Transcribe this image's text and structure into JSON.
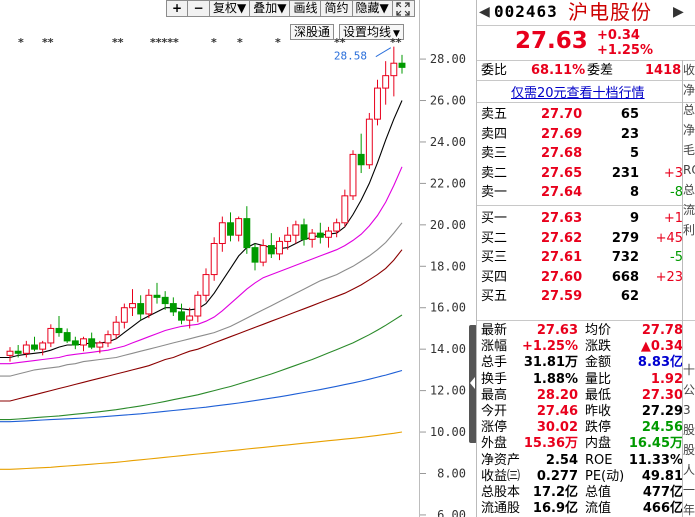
{
  "toolbar": {
    "plus": "+",
    "minus": "−",
    "fuquan": "复权▼",
    "diejia": "叠加▼",
    "huaxian": "画线",
    "jianyue": "简约",
    "yincang": "隐藏▼",
    "expand_icon": "expand-icon"
  },
  "buttons": {
    "deep": "深股通",
    "ma_settings": "设置均线",
    "ma_caret": "▼"
  },
  "annotation": {
    "high_label": "28.58"
  },
  "stars": [
    {
      "text": "*"
    },
    {
      "text": "**"
    },
    {
      "text": "**"
    },
    {
      "text": "*****"
    },
    {
      "text": "*"
    },
    {
      "text": "*"
    },
    {
      "text": "*"
    },
    {
      "text": "**"
    },
    {
      "text": "**"
    }
  ],
  "chart_data": {
    "type": "candlestick",
    "y_ticks": [
      "28.00",
      "26.00",
      "24.00",
      "22.00",
      "20.00",
      "18.00",
      "16.00",
      "14.00",
      "12.00",
      "10.00",
      "8.00",
      "6.00"
    ],
    "ylim": [
      5.9,
      29.5
    ],
    "candles": [
      [
        13.7,
        14.1,
        13.4,
        13.9
      ],
      [
        13.9,
        14.2,
        13.6,
        13.8
      ],
      [
        13.8,
        14.4,
        13.6,
        14.2
      ],
      [
        14.2,
        14.6,
        13.9,
        14.0
      ],
      [
        14.0,
        14.4,
        13.7,
        14.3
      ],
      [
        14.3,
        15.2,
        14.1,
        15.0
      ],
      [
        15.0,
        15.6,
        14.6,
        14.8
      ],
      [
        14.8,
        15.0,
        14.3,
        14.4
      ],
      [
        14.4,
        14.6,
        14.0,
        14.2
      ],
      [
        14.2,
        14.6,
        13.9,
        14.5
      ],
      [
        14.5,
        14.8,
        14.0,
        14.1
      ],
      [
        14.1,
        14.4,
        13.8,
        14.3
      ],
      [
        14.3,
        14.9,
        14.1,
        14.7
      ],
      [
        14.7,
        15.6,
        14.5,
        15.3
      ],
      [
        15.3,
        16.2,
        15.0,
        16.0
      ],
      [
        16.0,
        16.9,
        15.6,
        16.2
      ],
      [
        16.2,
        16.6,
        15.4,
        15.7
      ],
      [
        15.7,
        16.9,
        15.5,
        16.6
      ],
      [
        16.6,
        17.2,
        16.2,
        16.5
      ],
      [
        16.5,
        16.8,
        15.9,
        16.2
      ],
      [
        16.2,
        16.5,
        15.6,
        15.8
      ],
      [
        15.8,
        16.2,
        15.2,
        15.4
      ],
      [
        15.4,
        16.0,
        15.0,
        15.6
      ],
      [
        15.6,
        16.8,
        15.3,
        16.6
      ],
      [
        16.6,
        17.9,
        16.3,
        17.6
      ],
      [
        17.6,
        19.4,
        17.3,
        19.1
      ],
      [
        19.1,
        20.4,
        18.7,
        20.1
      ],
      [
        20.1,
        20.6,
        19.2,
        19.5
      ],
      [
        19.5,
        20.4,
        19.2,
        20.3
      ],
      [
        20.3,
        20.9,
        18.6,
        18.9
      ],
      [
        18.9,
        19.1,
        17.8,
        18.2
      ],
      [
        18.2,
        19.3,
        18.0,
        19.0
      ],
      [
        19.0,
        19.6,
        18.4,
        18.6
      ],
      [
        18.6,
        19.4,
        18.3,
        19.2
      ],
      [
        19.2,
        19.9,
        18.8,
        19.5
      ],
      [
        19.5,
        20.2,
        19.1,
        20.0
      ],
      [
        20.0,
        20.3,
        19.0,
        19.3
      ],
      [
        19.3,
        19.8,
        18.9,
        19.6
      ],
      [
        19.6,
        20.1,
        19.1,
        19.4
      ],
      [
        19.4,
        19.9,
        18.9,
        19.7
      ],
      [
        19.7,
        20.3,
        19.4,
        20.1
      ],
      [
        20.1,
        21.7,
        19.9,
        21.4
      ],
      [
        21.4,
        23.6,
        21.2,
        23.4
      ],
      [
        23.4,
        24.4,
        22.5,
        22.9
      ],
      [
        22.9,
        25.4,
        22.7,
        25.1
      ],
      [
        25.1,
        27.0,
        24.8,
        26.6
      ],
      [
        26.6,
        27.9,
        25.8,
        27.2
      ],
      [
        27.2,
        28.6,
        26.2,
        27.8
      ],
      [
        27.8,
        28.2,
        27.3,
        27.6
      ]
    ],
    "ma_lines": [
      {
        "color": "#000000",
        "values": [
          13.6,
          13.7,
          13.75,
          13.8,
          13.85,
          13.95,
          14.1,
          14.2,
          14.2,
          14.25,
          14.3,
          14.3,
          14.35,
          14.5,
          14.8,
          15.1,
          15.4,
          15.6,
          15.8,
          16.0,
          16.0,
          15.95,
          15.9,
          15.95,
          16.2,
          16.7,
          17.3,
          17.9,
          18.5,
          18.9,
          19.1,
          19.0,
          18.9,
          18.85,
          18.9,
          19.1,
          19.3,
          19.4,
          19.5,
          19.55,
          19.6,
          19.9,
          20.5,
          21.2,
          22.0,
          23.0,
          24.1,
          25.1,
          26.0
        ]
      },
      {
        "color": "#e000e0",
        "values": [
          13.3,
          13.35,
          13.4,
          13.45,
          13.5,
          13.55,
          13.6,
          13.7,
          13.75,
          13.8,
          13.85,
          13.9,
          13.95,
          14.05,
          14.15,
          14.3,
          14.45,
          14.6,
          14.75,
          14.9,
          15.0,
          15.1,
          15.15,
          15.2,
          15.35,
          15.55,
          15.85,
          16.2,
          16.55,
          16.9,
          17.2,
          17.45,
          17.6,
          17.75,
          17.9,
          18.05,
          18.2,
          18.35,
          18.5,
          18.65,
          18.8,
          19.0,
          19.25,
          19.55,
          19.95,
          20.45,
          21.1,
          21.9,
          22.8
        ]
      },
      {
        "color": "#8c8c8c",
        "values": [
          12.7,
          12.8,
          12.9,
          13.0,
          13.05,
          13.1,
          13.15,
          13.25,
          13.3,
          13.4,
          13.45,
          13.5,
          13.55,
          13.6,
          13.7,
          13.8,
          13.9,
          14.0,
          14.1,
          14.2,
          14.3,
          14.4,
          14.5,
          14.6,
          14.7,
          14.8,
          14.95,
          15.1,
          15.3,
          15.5,
          15.7,
          15.9,
          16.1,
          16.3,
          16.5,
          16.7,
          16.9,
          17.1,
          17.3,
          17.45,
          17.6,
          17.8,
          18.0,
          18.25,
          18.5,
          18.8,
          19.15,
          19.6,
          20.1
        ]
      },
      {
        "color": "#8b0000",
        "values": [
          11.5,
          11.6,
          11.7,
          11.8,
          11.9,
          12.0,
          12.1,
          12.2,
          12.3,
          12.4,
          12.5,
          12.6,
          12.7,
          12.8,
          12.9,
          13.0,
          13.1,
          13.2,
          13.35,
          13.5,
          13.6,
          13.75,
          13.9,
          14.0,
          14.15,
          14.3,
          14.45,
          14.6,
          14.75,
          14.9,
          15.05,
          15.2,
          15.35,
          15.5,
          15.65,
          15.8,
          15.95,
          16.1,
          16.25,
          16.4,
          16.55,
          16.7,
          16.9,
          17.1,
          17.35,
          17.6,
          17.9,
          18.3,
          18.8
        ]
      },
      {
        "color": "#2a8a2a",
        "values": [
          10.6,
          10.63,
          10.66,
          10.69,
          10.72,
          10.75,
          10.78,
          10.82,
          10.86,
          10.9,
          10.94,
          10.98,
          11.03,
          11.08,
          11.14,
          11.2,
          11.26,
          11.33,
          11.4,
          11.48,
          11.56,
          11.64,
          11.72,
          11.8,
          11.9,
          12.0,
          12.1,
          12.2,
          12.32,
          12.44,
          12.56,
          12.68,
          12.8,
          12.94,
          13.08,
          13.22,
          13.36,
          13.5,
          13.66,
          13.82,
          13.98,
          14.14,
          14.3,
          14.5,
          14.7,
          14.92,
          15.15,
          15.4,
          15.65
        ]
      },
      {
        "color": "#1e5fd6",
        "values": [
          10.5,
          10.52,
          10.54,
          10.56,
          10.58,
          10.6,
          10.62,
          10.64,
          10.66,
          10.68,
          10.7,
          10.73,
          10.76,
          10.79,
          10.82,
          10.85,
          10.88,
          10.92,
          10.96,
          11.0,
          11.04,
          11.08,
          11.12,
          11.16,
          11.2,
          11.25,
          11.3,
          11.35,
          11.4,
          11.46,
          11.52,
          11.58,
          11.64,
          11.7,
          11.77,
          11.84,
          11.91,
          11.98,
          12.05,
          12.13,
          12.21,
          12.29,
          12.37,
          12.46,
          12.55,
          12.65,
          12.75,
          12.86,
          12.97
        ]
      },
      {
        "color": "#e8a000",
        "values": [
          8.2,
          8.22,
          8.24,
          8.26,
          8.28,
          8.3,
          8.33,
          8.36,
          8.39,
          8.42,
          8.45,
          8.48,
          8.51,
          8.54,
          8.58,
          8.62,
          8.66,
          8.7,
          8.74,
          8.78,
          8.82,
          8.86,
          8.9,
          8.94,
          8.98,
          9.02,
          9.06,
          9.1,
          9.14,
          9.18,
          9.22,
          9.26,
          9.3,
          9.34,
          9.38,
          9.42,
          9.46,
          9.5,
          9.54,
          9.58,
          9.62,
          9.66,
          9.7,
          9.74,
          9.79,
          9.84,
          9.89,
          9.94,
          10.0
        ]
      }
    ]
  },
  "header": {
    "code": "002463",
    "name": "沪电股份",
    "left_arrow": "◀",
    "right_arrow": "▶"
  },
  "quote": {
    "price": "27.63",
    "change": "+0.34",
    "change_pct": "+1.25%"
  },
  "weibi": {
    "label": "委比",
    "value": "68.11%",
    "label2": "委差",
    "value2": "1418"
  },
  "depth_link": "仅需20元查看十档行情",
  "asks": [
    {
      "label": "卖五",
      "price": "27.70",
      "vol": "65",
      "chg": ""
    },
    {
      "label": "卖四",
      "price": "27.69",
      "vol": "23",
      "chg": ""
    },
    {
      "label": "卖三",
      "price": "27.68",
      "vol": "5",
      "chg": ""
    },
    {
      "label": "卖二",
      "price": "27.65",
      "vol": "231",
      "chg": "+3"
    },
    {
      "label": "卖一",
      "price": "27.64",
      "vol": "8",
      "chg": "-8"
    }
  ],
  "bids": [
    {
      "label": "买一",
      "price": "27.63",
      "vol": "9",
      "chg": "+1"
    },
    {
      "label": "买二",
      "price": "27.62",
      "vol": "279",
      "chg": "+45"
    },
    {
      "label": "买三",
      "price": "27.61",
      "vol": "732",
      "chg": "-5"
    },
    {
      "label": "买四",
      "price": "27.60",
      "vol": "668",
      "chg": "+23"
    },
    {
      "label": "买五",
      "price": "27.59",
      "vol": "62",
      "chg": ""
    }
  ],
  "stats": [
    {
      "l1": "最新",
      "v1": "27.63",
      "c1": "red",
      "l2": "均价",
      "v2": "27.78",
      "c2": "red"
    },
    {
      "l1": "涨幅",
      "v1": "+1.25%",
      "c1": "red",
      "l2": "涨跌",
      "v2": "▲0.34",
      "c2": "red"
    },
    {
      "l1": "总手",
      "v1": "31.81万",
      "c1": "",
      "l2": "金额",
      "v2": "8.83亿",
      "c2": "blue"
    },
    {
      "l1": "换手",
      "v1": "1.88%",
      "c1": "",
      "l2": "量比",
      "v2": "1.92",
      "c2": "red"
    },
    {
      "l1": "最高",
      "v1": "28.20",
      "c1": "red",
      "l2": "最低",
      "v2": "27.30",
      "c2": "red"
    },
    {
      "l1": "今开",
      "v1": "27.46",
      "c1": "red",
      "l2": "昨收",
      "v2": "27.29",
      "c2": ""
    },
    {
      "l1": "涨停",
      "v1": "30.02",
      "c1": "red",
      "l2": "跌停",
      "v2": "24.56",
      "c2": "green"
    },
    {
      "l1": "外盘",
      "v1": "15.36万",
      "c1": "red",
      "l2": "内盘",
      "v2": "16.45万",
      "c2": "green"
    },
    {
      "l1": "净资产",
      "v1": "2.54",
      "c1": "",
      "l2": "ROE",
      "v2": "11.33%",
      "c2": ""
    },
    {
      "l1": "收益㈢",
      "v1": "0.277",
      "c1": "",
      "l2": "PE(动)",
      "v2": "49.81",
      "c2": ""
    },
    {
      "l1": "总股本",
      "v1": "17.2亿",
      "c1": "",
      "l2": "总值",
      "v2": "477亿",
      "c2": ""
    },
    {
      "l1": "流通股",
      "v1": "16.9亿",
      "c1": "",
      "l2": "流值",
      "v2": "466亿",
      "c2": ""
    }
  ],
  "edge_chars": [
    "收",
    "净",
    "总",
    "净",
    "毛",
    "RO",
    "总",
    "流",
    "利",
    "",
    "",
    "",
    "",
    "",
    "",
    "十",
    "公",
    "3",
    "股",
    "股",
    "人",
    "一",
    "年"
  ]
}
